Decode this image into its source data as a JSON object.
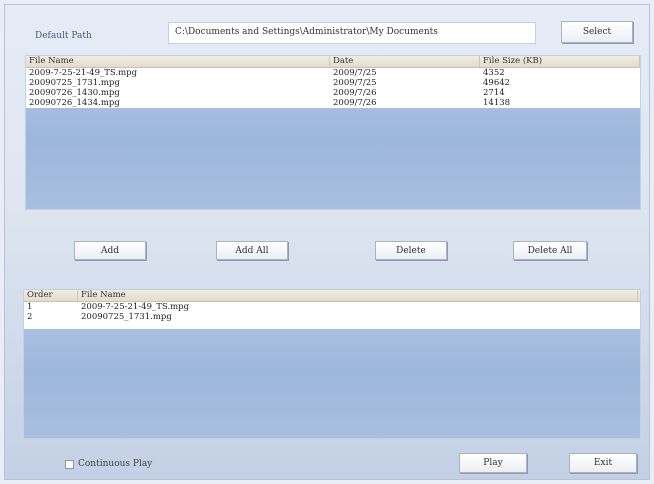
{
  "path": {
    "label": "Default Path",
    "value": "C:\\Documents and Settings\\Administrator\\My Documents",
    "select_label": "Select"
  },
  "file_table": {
    "columns": [
      "File Name",
      "Date",
      "File Size (KB)"
    ],
    "rows": [
      [
        "2009-7-25-21-49_TS.mpg",
        "2009/7/25",
        "4352"
      ],
      [
        "20090725_1731.mpg",
        "2009/7/25",
        "49642"
      ],
      [
        "20090726_1430.mpg",
        "2009/7/26",
        "2714"
      ],
      [
        "20090726_1434.mpg",
        "2009/7/26",
        "14138"
      ]
    ]
  },
  "actions": {
    "add": "Add",
    "add_all": "Add All",
    "delete": "Delete",
    "delete_all": "Delete All"
  },
  "play_table": {
    "columns": [
      "Order",
      "File Name"
    ],
    "rows": [
      [
        "1",
        "2009-7-25-21-49_TS.mpg"
      ],
      [
        "2",
        "20090725_1731.mpg"
      ]
    ]
  },
  "footer": {
    "continuous_label": "Continuous Play",
    "continuous_checked": false,
    "play_label": "Play",
    "exit_label": "Exit"
  }
}
